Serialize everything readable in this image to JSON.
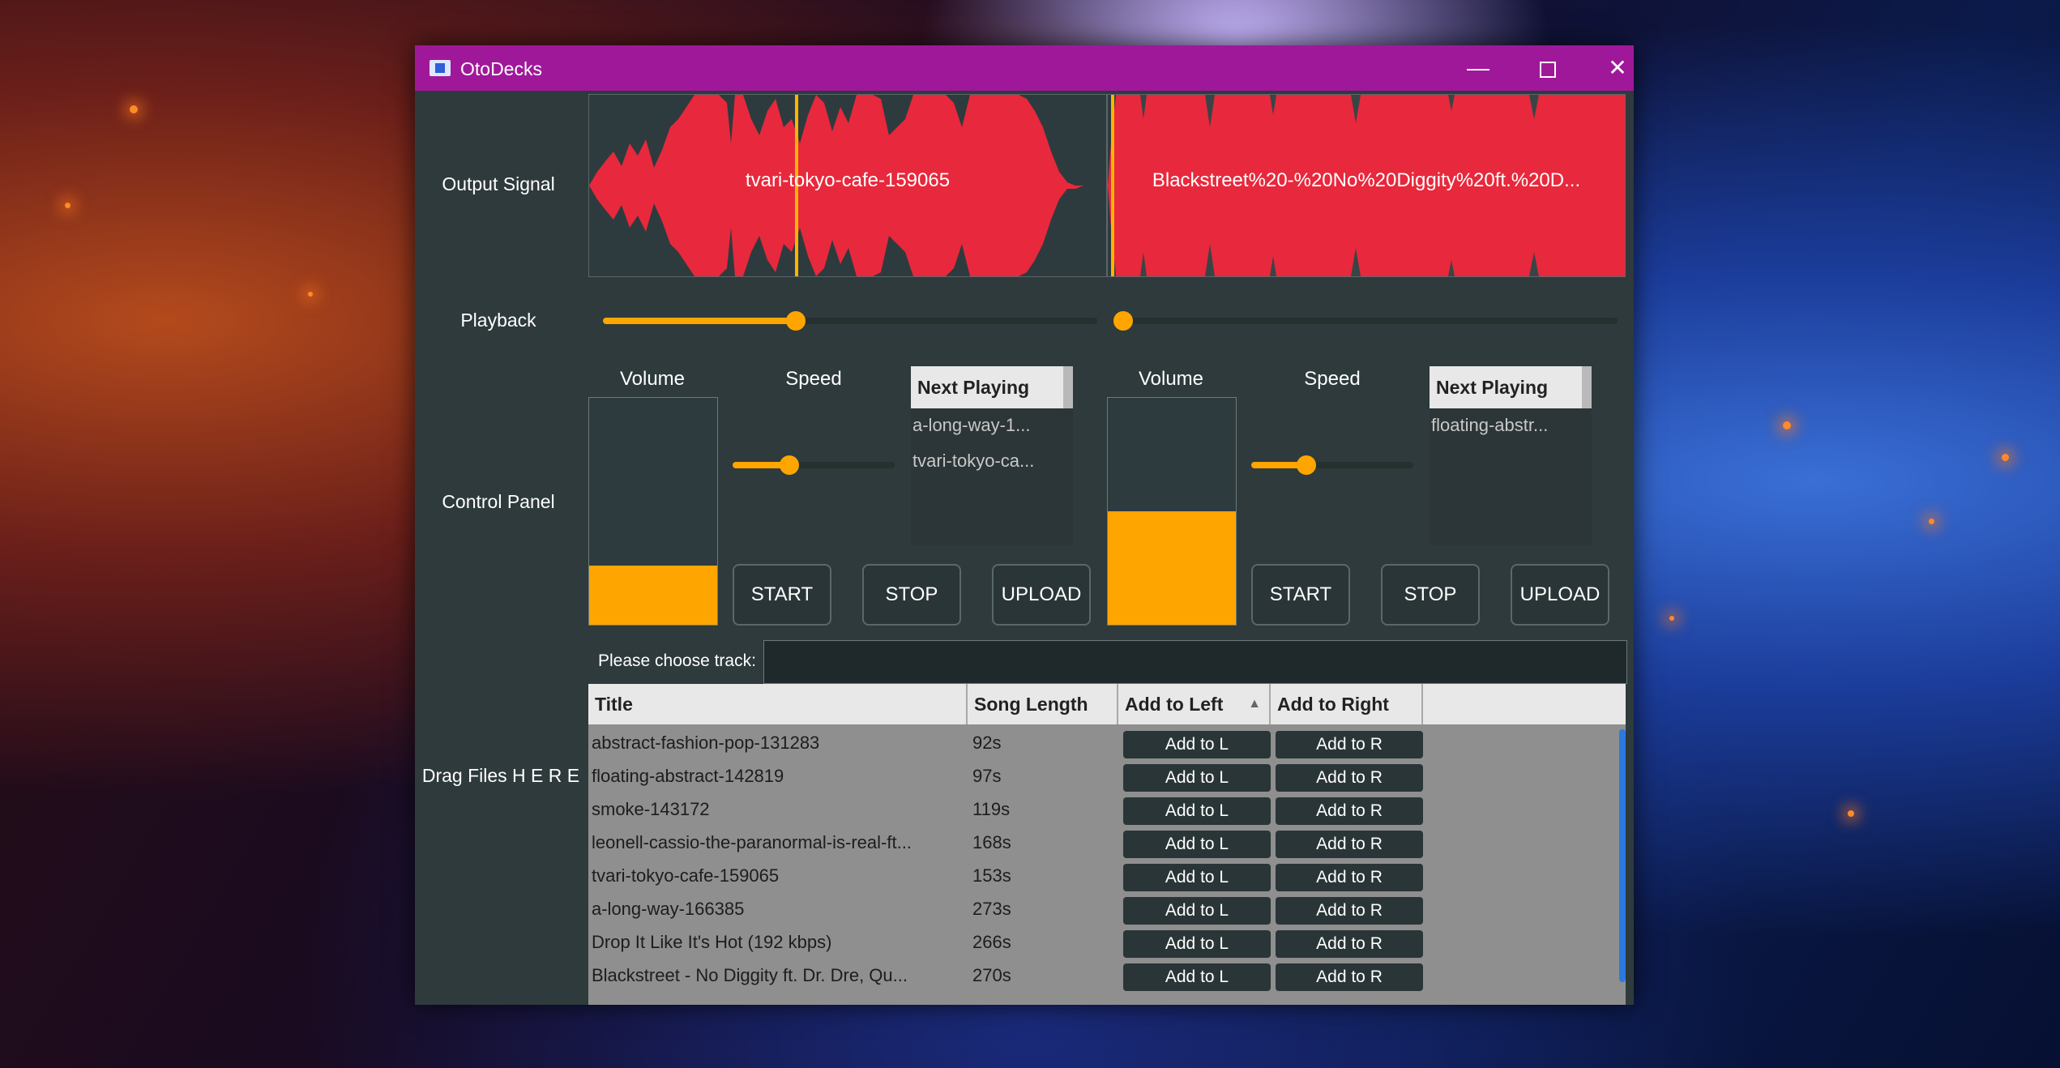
{
  "window": {
    "title": "OtoDecks",
    "controls": {
      "minimize": "—",
      "maximize": "",
      "close": "✕"
    }
  },
  "labels": {
    "output_signal": "Output Signal",
    "playback": "Playback",
    "control_panel": "Control Panel",
    "drag_files": "Drag Files H E R E"
  },
  "decks": [
    {
      "track_title": "tvari-tokyo-cafe-159065",
      "playhead_fraction": 0.4,
      "playback_fraction": 0.39,
      "volume_label": "Volume",
      "volume_fraction": 0.26,
      "speed_label": "Speed",
      "speed_fraction": 0.35,
      "next_playing_header": "Next Playing",
      "next_playing": [
        "a-long-way-1...",
        "tvari-tokyo-ca..."
      ],
      "buttons": {
        "start": "START",
        "stop": "STOP",
        "upload": "UPLOAD"
      }
    },
    {
      "track_title": "Blackstreet%20-%20No%20Diggity%20ft.%20D...",
      "playhead_fraction": 0.01,
      "playback_fraction": 0.0,
      "volume_label": "Volume",
      "volume_fraction": 0.5,
      "speed_label": "Speed",
      "speed_fraction": 0.34,
      "next_playing_header": "Next Playing",
      "next_playing": [
        "floating-abstr..."
      ],
      "buttons": {
        "start": "START",
        "stop": "STOP",
        "upload": "UPLOAD"
      }
    }
  ],
  "search": {
    "label": "Please choose track:",
    "value": ""
  },
  "table": {
    "columns": [
      "Title",
      "Song Length",
      "Add to Left",
      "Add to Right"
    ],
    "sort_indicator": "▲",
    "add_left_label": "Add to L",
    "add_right_label": "Add to R",
    "rows": [
      {
        "title": "abstract-fashion-pop-131283",
        "length": "92s"
      },
      {
        "title": "floating-abstract-142819",
        "length": "97s"
      },
      {
        "title": "smoke-143172",
        "length": "119s"
      },
      {
        "title": "leonell-cassio-the-paranormal-is-real-ft...",
        "length": "168s"
      },
      {
        "title": "tvari-tokyo-cafe-159065",
        "length": "153s"
      },
      {
        "title": "a-long-way-166385",
        "length": "273s"
      },
      {
        "title": "Drop It Like It's Hot (192 kbps)",
        "length": "266s"
      },
      {
        "title": "Blackstreet - No Diggity ft. Dr. Dre, Qu...",
        "length": "270s"
      }
    ]
  },
  "colors": {
    "titlebar": "#a0189a",
    "waveform": "#e8283c",
    "accent": "#ffa500",
    "panel": "#2e3a3c"
  }
}
